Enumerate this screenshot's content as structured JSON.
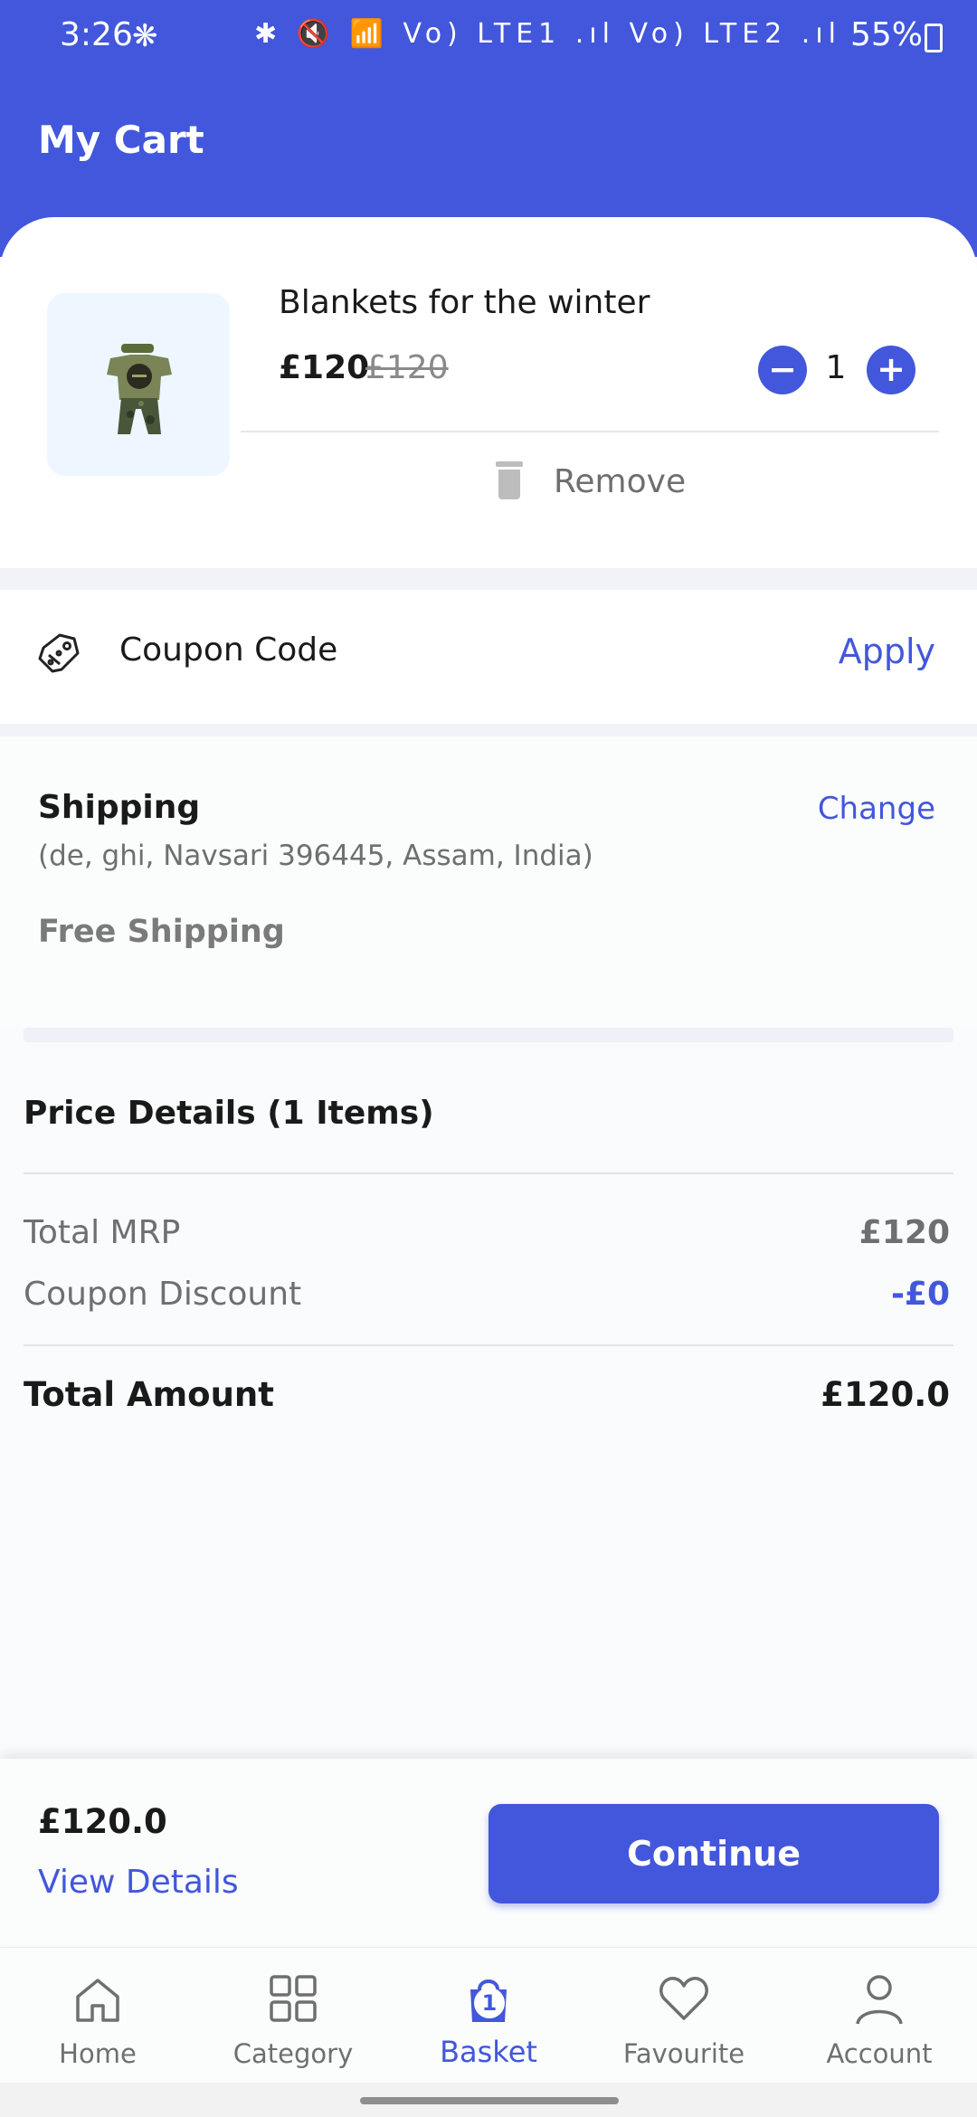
{
  "status_bar": {
    "time": "3:26",
    "network_icons": "✱ 🔇 📶 Vo) LTE1 .ıl Vo) LTE2 .ıl",
    "battery": "55%"
  },
  "header": {
    "title": "My Cart"
  },
  "cart_item": {
    "name": "Blankets for the winter",
    "price": "£120",
    "original_price": "£120",
    "quantity": "1",
    "minus_symbol": "−",
    "plus_symbol": "+",
    "remove_label": "Remove"
  },
  "coupon": {
    "label": "Coupon Code",
    "apply_label": "Apply"
  },
  "shipping": {
    "title": "Shipping",
    "change_label": "Change",
    "address": "(de, ghi, Navsari 396445, Assam, India)",
    "method": "Free Shipping"
  },
  "price_details": {
    "title": "Price Details (1 Items)",
    "rows": [
      {
        "label": "Total MRP",
        "value": "£120"
      },
      {
        "label": "Coupon Discount",
        "value": "-£0"
      }
    ],
    "total_label": "Total Amount",
    "total_value": "£120.0"
  },
  "checkout": {
    "total": "£120.0",
    "view_details_label": "View Details",
    "continue_label": "Continue"
  },
  "bottom_nav": {
    "items": [
      {
        "label": "Home",
        "icon": "home-icon"
      },
      {
        "label": "Category",
        "icon": "grid-icon"
      },
      {
        "label": "Basket",
        "icon": "basket-icon",
        "badge": "1",
        "active": true
      },
      {
        "label": "Favourite",
        "icon": "heart-icon"
      },
      {
        "label": "Account",
        "icon": "person-icon"
      }
    ]
  },
  "colors": {
    "brand": "#4257db",
    "text_primary": "#1a1a1a",
    "text_secondary": "#6f6f6f",
    "background": "#f9fbfc"
  }
}
